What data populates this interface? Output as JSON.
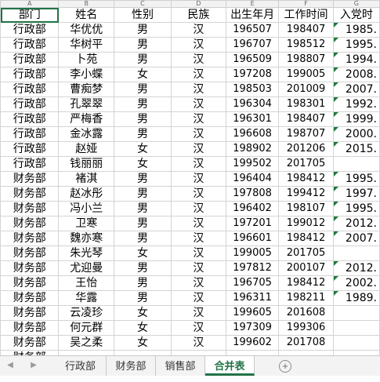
{
  "columns": [
    "A",
    "B",
    "C",
    "D",
    "E",
    "F",
    "G"
  ],
  "headers": [
    "部门",
    "姓名",
    "性别",
    "民族",
    "出生年月",
    "工作时间",
    "入党时"
  ],
  "rows": [
    [
      "行政部",
      "华优优",
      "男",
      "汉",
      "196507",
      "198407",
      "1985."
    ],
    [
      "行政部",
      "华树平",
      "男",
      "汉",
      "196707",
      "198512",
      "1995."
    ],
    [
      "行政部",
      "卜苑",
      "男",
      "汉",
      "196509",
      "198807",
      "1994."
    ],
    [
      "行政部",
      "李小蝶",
      "女",
      "汉",
      "197208",
      "199005",
      "2008."
    ],
    [
      "行政部",
      "曹痴梦",
      "男",
      "汉",
      "198503",
      "201009",
      "2007."
    ],
    [
      "行政部",
      "孔翠翠",
      "男",
      "汉",
      "196304",
      "198301",
      "1992."
    ],
    [
      "行政部",
      "严梅香",
      "男",
      "汉",
      "196301",
      "198407",
      "1999."
    ],
    [
      "行政部",
      "金冰露",
      "男",
      "汉",
      "196608",
      "198707",
      "2000."
    ],
    [
      "行政部",
      "赵娅",
      "女",
      "汉",
      "198902",
      "201206",
      "2015."
    ],
    [
      "行政部",
      "钱丽丽",
      "女",
      "汉",
      "199502",
      "201705",
      ""
    ],
    [
      "财务部",
      "褚淇",
      "男",
      "汉",
      "196404",
      "198412",
      "1995."
    ],
    [
      "财务部",
      "赵冰彤",
      "男",
      "汉",
      "197808",
      "199412",
      "1997."
    ],
    [
      "财务部",
      "冯小兰",
      "男",
      "汉",
      "196402",
      "198107",
      "1995."
    ],
    [
      "财务部",
      "卫寒",
      "男",
      "汉",
      "197201",
      "199012",
      "2012."
    ],
    [
      "财务部",
      "魏亦寒",
      "男",
      "汉",
      "196601",
      "198412",
      "2007."
    ],
    [
      "财务部",
      "朱光琴",
      "女",
      "汉",
      "199005",
      "201705",
      ""
    ],
    [
      "财务部",
      "尤迎曼",
      "男",
      "汉",
      "197812",
      "200107",
      "2012."
    ],
    [
      "财务部",
      "王怡",
      "男",
      "汉",
      "196705",
      "198412",
      "2002."
    ],
    [
      "财务部",
      "华露",
      "男",
      "汉",
      "196311",
      "198211",
      "1989."
    ],
    [
      "财务部",
      "云凌珍",
      "女",
      "汉",
      "199605",
      "201608",
      ""
    ],
    [
      "财务部",
      "何元群",
      "女",
      "汉",
      "197309",
      "199306",
      ""
    ],
    [
      "财务部",
      "吴之柔",
      "女",
      "汉",
      "199602",
      "201708",
      ""
    ],
    [
      "财务部",
      "",
      "",
      "",
      "",
      "",
      ""
    ]
  ],
  "sheet_tabs": [
    "行政部",
    "财务部",
    "销售部",
    "合并表"
  ],
  "active_tab": "合并表",
  "nav_icons": [
    "triangle-left-icon",
    "triangle-right-icon"
  ],
  "accent_color": "#217346"
}
